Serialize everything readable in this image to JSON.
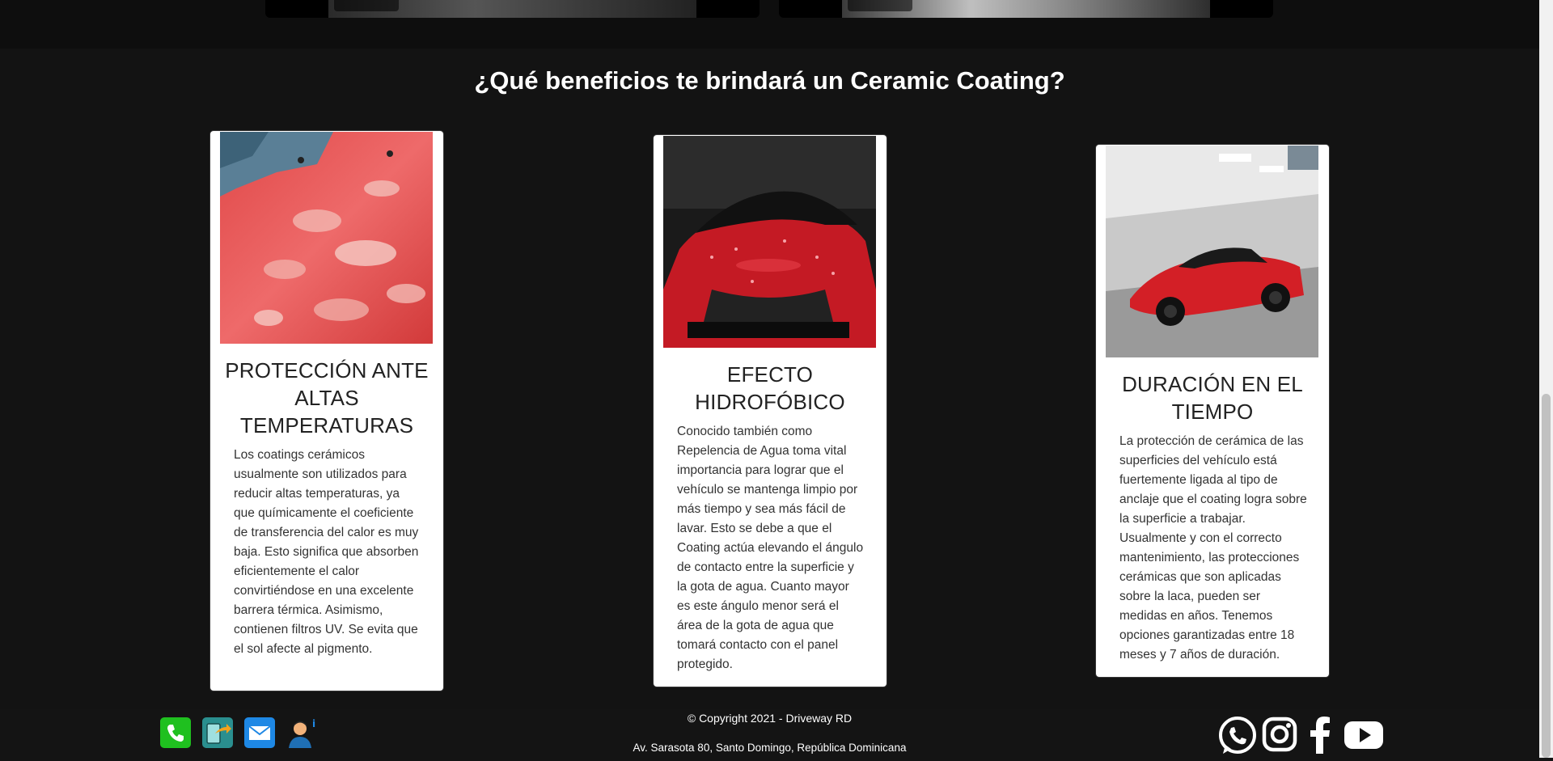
{
  "section": {
    "title": "¿Qué beneficios te brindará un Ceramic Coating?"
  },
  "cards": [
    {
      "title": "PROTECCIÓN ANTE ALTAS TEMPERATURAS",
      "body": "Los coatings cerámicos usualmente son utilizados para reducir altas temperaturas, ya que químicamente el coeficiente de transferencia del calor es muy baja. Esto significa que absorben eficientemente el calor convirtiéndose en una excelente barrera térmica. Asimismo, contienen filtros UV. Se evita que el sol afecte al pigmento."
    },
    {
      "title": "EFECTO HIDROFÓBICO",
      "body": "Conocido también como Repelencia de Agua toma vital importancia para lograr que el vehículo se mantenga limpio por más tiempo y sea más fácil de lavar. Esto se debe a que el Coating actúa elevando el ángulo de contacto entre la superficie y la gota de agua. Cuanto mayor es este ángulo menor será el área de la gota de agua que tomará contacto con el panel protegido."
    },
    {
      "title": "DURACIÓN EN EL TIEMPO",
      "body": "La protección de cerámica de las superficies del vehículo está fuertemente ligada al tipo de anclaje que el coating logra sobre la superficie a trabajar. Usualmente y con el correcto mantenimiento, las protecciones cerámicas que son aplicadas sobre la laca, pueden ser medidas en años. Tenemos opciones garantizadas entre 18 meses y 7 años de duración."
    }
  ],
  "footer": {
    "copyright": "© Copyright 2021 - Driveway RD",
    "address": "Av. Sarasota 80, Santo Domingo, República Dominicana"
  },
  "icons": {
    "contact": [
      "phone-icon",
      "share-icon",
      "email-icon",
      "info-person-icon"
    ],
    "social": [
      "whatsapp-icon",
      "instagram-icon",
      "facebook-icon",
      "youtube-icon"
    ]
  },
  "colors": {
    "phone_green": "#1fc01f",
    "share_teal": "#2a8f8f",
    "email_blue": "#1e88e5",
    "card_bg": "#ffffff",
    "page_bg": "#131313"
  }
}
